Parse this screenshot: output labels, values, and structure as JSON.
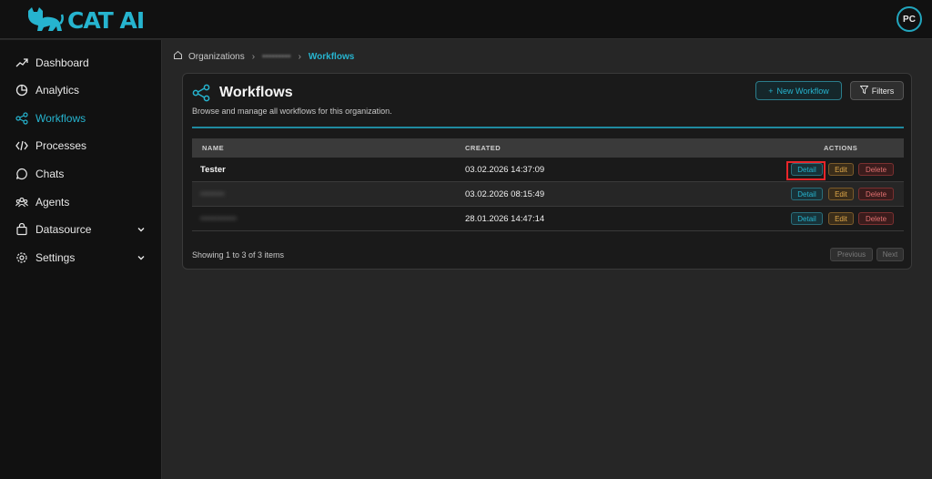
{
  "app": {
    "name": "CAT AI",
    "user_initials": "PC",
    "brand_color": "#26b4cf"
  },
  "sidebar": {
    "items": [
      {
        "label": "Dashboard",
        "icon": "trending-up-icon"
      },
      {
        "label": "Analytics",
        "icon": "pie-chart-icon"
      },
      {
        "label": "Workflows",
        "icon": "share-icon",
        "active": true
      },
      {
        "label": "Processes",
        "icon": "code-icon"
      },
      {
        "label": "Chats",
        "icon": "chat-bubble-icon"
      },
      {
        "label": "Agents",
        "icon": "users-icon"
      },
      {
        "label": "Datasource",
        "icon": "shopping-bag-icon",
        "expandable": true
      },
      {
        "label": "Settings",
        "icon": "gear-icon",
        "expandable": true
      }
    ]
  },
  "breadcrumb": {
    "root": "Organizations",
    "middle": "•••••••••",
    "current": "Workflows"
  },
  "page": {
    "title": "Workflows",
    "subtitle": "Browse and manage all workflows for this organization.",
    "new_button": "New Workflow",
    "filter_button": "Filters"
  },
  "table": {
    "columns": {
      "name": "NAME",
      "created": "CREATED",
      "actions": "ACTIONS"
    },
    "rows": [
      {
        "name": "Tester",
        "created": "03.02.2026 14:37:09"
      },
      {
        "name": "••••••••",
        "created": "03.02.2026 08:15:49"
      },
      {
        "name": "••••••••••••",
        "created": "28.01.2026 14:47:14"
      }
    ],
    "action_labels": {
      "detail": "Detail",
      "edit": "Edit",
      "delete": "Delete"
    }
  },
  "pagination": {
    "summary": "Showing 1 to 3 of 3 items",
    "previous": "Previous",
    "next": "Next"
  }
}
